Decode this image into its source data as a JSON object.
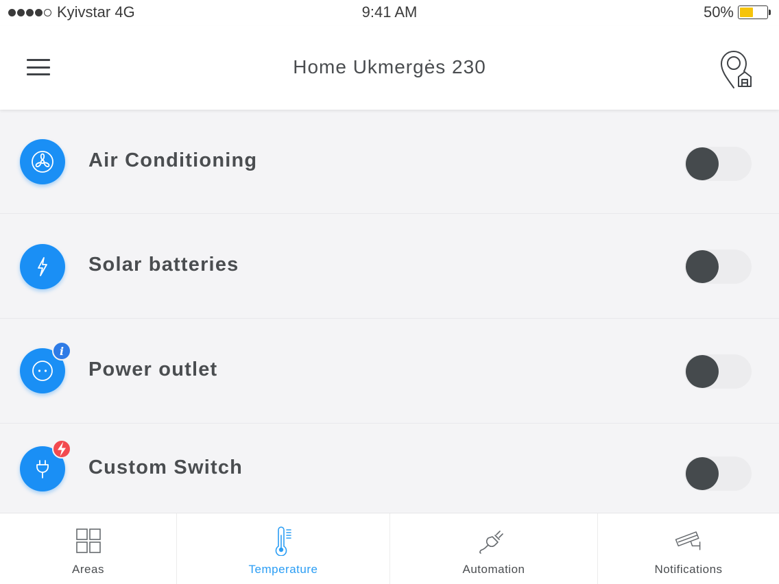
{
  "status_bar": {
    "carrier": "Kyivstar 4G",
    "signal_bars": 4,
    "signal_max": 5,
    "time": "9:41 AM",
    "battery_percent": "50%",
    "battery_level": 0.5,
    "battery_color": "#f6c40b"
  },
  "header": {
    "title": "Home Ukmergės 230",
    "menu_icon": "hamburger-menu-icon",
    "location_icon": "location-home-pin-icon"
  },
  "devices": [
    {
      "label": "Air Conditioning",
      "icon": "fan-icon",
      "badge": null,
      "on": false
    },
    {
      "label": "Solar batteries",
      "icon": "lightning-icon",
      "badge": null,
      "on": false
    },
    {
      "label": "Power outlet",
      "icon": "power-outlet-icon",
      "badge": {
        "type": "info",
        "text": "i"
      },
      "on": false
    },
    {
      "label": "Custom Switch",
      "icon": "plug-icon",
      "badge": {
        "type": "alert",
        "icon": "lightning-icon"
      },
      "on": false
    }
  ],
  "tabs": [
    {
      "label": "Areas",
      "icon": "grid-icon",
      "active": false
    },
    {
      "label": "Temperature",
      "icon": "thermometer-icon",
      "active": true
    },
    {
      "label": "Automation",
      "icon": "plug-cable-icon",
      "active": false
    },
    {
      "label": "Notifications",
      "icon": "security-camera-icon",
      "active": false
    }
  ],
  "colors": {
    "accent": "#1a8ff5",
    "active_tab": "#2a9df4",
    "info_badge": "#2e7be6",
    "alert_badge": "#f24a4f",
    "toggle_knob": "#454a4d",
    "toggle_track": "#ececee"
  }
}
